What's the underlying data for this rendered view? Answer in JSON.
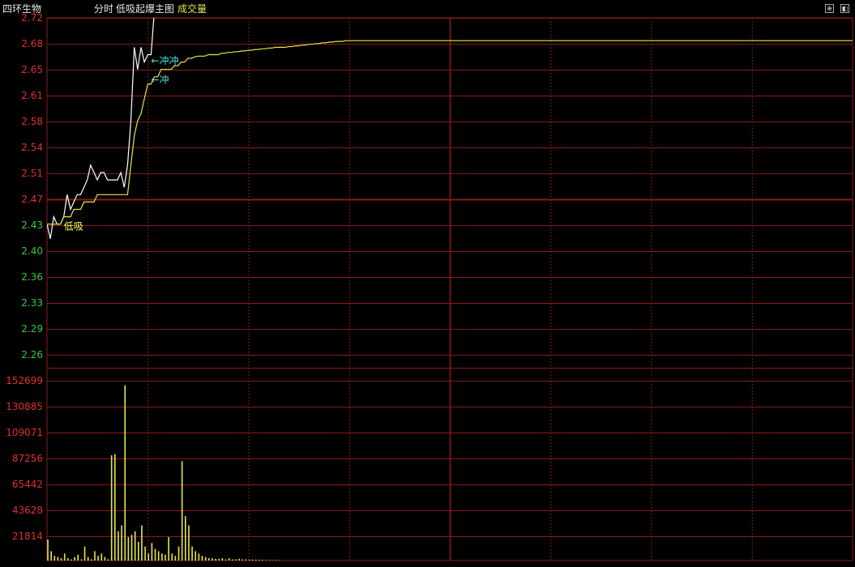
{
  "titlebar": {
    "stock_name": "四环生物",
    "mode": "分时",
    "indicator": "低吸起爆主图",
    "volume_label": "成交量",
    "buttons": [
      "⊕",
      "◧"
    ]
  },
  "colors": {
    "background": "#000000",
    "grid": "#8b1a1a",
    "axis_up": "#e03030",
    "axis_down": "#3cc83c",
    "price_line": "#ffffff",
    "avg_line": "#e6e64a",
    "volume_bar": "#e6e64a",
    "signal_cyan": "#4de8e8",
    "signal_yellow": "#ffff66"
  },
  "chart_data": [
    {
      "type": "line",
      "panel": "price",
      "y_ticks": [
        "2.72",
        "2.68",
        "2.65",
        "2.61",
        "2.58",
        "2.54",
        "2.51",
        "2.47",
        "2.43",
        "2.40",
        "2.36",
        "2.33",
        "2.29",
        "2.26"
      ],
      "ylim": [
        2.245,
        2.72
      ],
      "x_minutes": 241,
      "series": [
        {
          "values": [
            2.44,
            2.42,
            2.45,
            2.44,
            2.44,
            2.45,
            2.48,
            2.46,
            2.47,
            2.48,
            2.48,
            2.49,
            2.5,
            2.52,
            2.51,
            2.5,
            2.51,
            2.51,
            2.5,
            2.5,
            2.5,
            2.5,
            2.51,
            2.49,
            2.52,
            2.58,
            2.68,
            2.65,
            2.68,
            2.66,
            2.67,
            2.67,
            2.73
          ]
        },
        {
          "values": [
            2.44,
            2.44,
            2.44,
            2.44,
            2.44,
            2.45,
            2.45,
            2.45,
            2.46,
            2.46,
            2.46,
            2.47,
            2.47,
            2.47,
            2.47,
            2.48,
            2.48,
            2.48,
            2.48,
            2.48,
            2.48,
            2.48,
            2.48,
            2.48,
            2.48,
            2.52,
            2.56,
            2.58,
            2.59,
            2.61,
            2.63,
            2.63,
            2.64,
            2.64,
            2.65,
            2.65,
            2.65,
            2.65,
            2.655,
            2.655,
            2.66,
            2.66,
            2.665,
            2.665,
            2.667,
            2.668,
            2.668,
            2.668,
            2.67,
            2.67,
            2.67,
            2.67,
            2.672,
            2.672,
            2.673,
            2.673,
            2.674,
            2.674,
            2.675,
            2.675,
            2.676,
            2.676,
            2.677,
            2.677,
            2.678,
            2.678,
            2.679,
            2.679,
            2.68,
            2.68,
            2.68,
            2.68,
            2.681,
            2.681,
            2.682,
            2.682,
            2.683,
            2.683,
            2.684,
            2.684,
            2.685,
            2.685,
            2.686,
            2.686,
            2.687,
            2.687,
            2.688,
            2.688,
            2.688,
            2.689,
            2.689
          ]
        }
      ],
      "annotations": [
        {
          "text": "低吸",
          "minute": 5,
          "price": 2.438,
          "color": "signal_yellow"
        },
        {
          "text": "←冲冲",
          "minute": 31,
          "price": 2.663,
          "color": "signal_cyan"
        },
        {
          "text": "←冲",
          "minute": 31,
          "price": 2.637,
          "color": "signal_cyan"
        }
      ]
    },
    {
      "type": "bar",
      "panel": "volume",
      "y_ticks": [
        "152699",
        "130885",
        "109071",
        "87256",
        "65442",
        "43628",
        "21814"
      ],
      "ylim": [
        0,
        165000
      ],
      "values": [
        18000,
        8000,
        4000,
        3000,
        2000,
        6000,
        2000,
        1000,
        3000,
        5000,
        1000,
        12000,
        3000,
        1000,
        8000,
        4000,
        6000,
        3000,
        1000,
        90000,
        91000,
        25000,
        30000,
        150000,
        20000,
        22000,
        25000,
        16000,
        30000,
        12000,
        6000,
        15000,
        10000,
        8000,
        6000,
        5000,
        20000,
        6000,
        4000,
        12000,
        85000,
        38000,
        30000,
        12000,
        8000,
        6000,
        4000,
        3000,
        2000,
        2000,
        1500,
        1500,
        2000,
        1000,
        2000,
        1000,
        1000,
        1500,
        1000,
        1000,
        800,
        800,
        800,
        600,
        600,
        500,
        500,
        400,
        400,
        400
      ]
    }
  ]
}
